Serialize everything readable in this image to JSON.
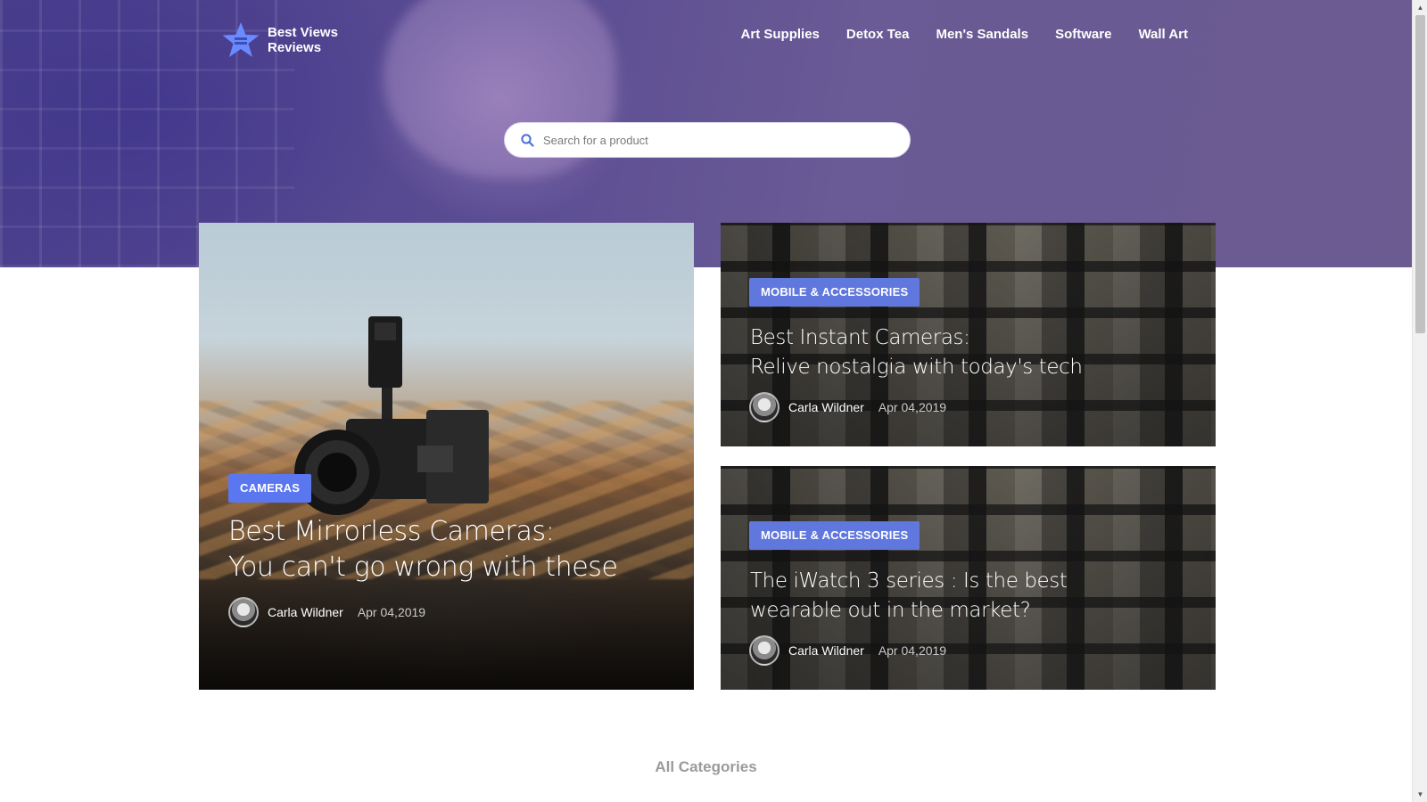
{
  "brand": {
    "line1": "Best Views",
    "line2": "Reviews",
    "logo_icon": "star-logo-icon",
    "accent": "#5b77f0"
  },
  "nav": {
    "items": [
      "Art Supplies",
      "Detox Tea",
      "Men's Sandals",
      "Software",
      "Wall Art"
    ]
  },
  "search": {
    "placeholder": "Search for a product",
    "value": ""
  },
  "featured": {
    "main": {
      "category": "CAMERAS",
      "title_line1": "Best Mirrorless Cameras:",
      "title_line2": "You can't go wrong with these",
      "author": "Carla Wildner",
      "date": "Apr 04,2019"
    },
    "side": [
      {
        "category": "MOBILE & ACCESSORIES",
        "title_line1": "Best Instant Cameras:",
        "title_line2": "Relive nostalgia with today's tech",
        "author": "Carla Wildner",
        "date": "Apr 04,2019"
      },
      {
        "category": "MOBILE & ACCESSORIES",
        "title_line1": "The iWatch 3 series : Is the best",
        "title_line2": "wearable out in the market?",
        "author": "Carla Wildner",
        "date": "Apr 04,2019"
      }
    ]
  },
  "sections": {
    "all_categories": "All Categories"
  },
  "colors": {
    "hero": "#5a4c93",
    "badge": "#5b77f0"
  }
}
